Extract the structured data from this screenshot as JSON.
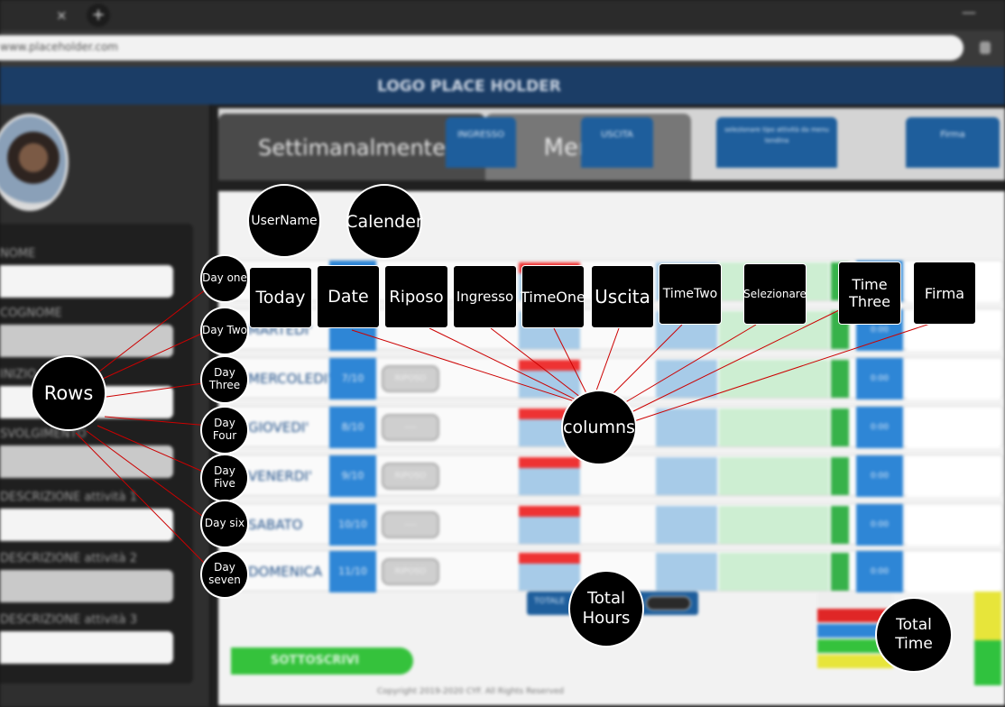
{
  "browser": {
    "tab_close": "×",
    "new_tab": "+",
    "minimize": "—",
    "url": "www.placeholder.com"
  },
  "app": {
    "logo": "LOGO PLACE HOLDER"
  },
  "sidebar": {
    "labels": [
      "NOME",
      "COGNOME",
      "INIZIO",
      "SVOLGIMENTO",
      "DESCRIZIONE attività 1",
      "DESCRIZIONE attività 2",
      "DESCRIZIONE attività 3"
    ]
  },
  "tabs": {
    "weekly": "Settimanalmente",
    "monthly": "Mensile"
  },
  "table": {
    "headers": {
      "ingresso": "INGRESSO",
      "uscita": "USCITA",
      "selezionare": "selezionare tipo attività da menu tendina",
      "firma": "Firma"
    },
    "rows": [
      {
        "day": "",
        "date": "",
        "riposo": ""
      },
      {
        "day": "MARTEDI'",
        "date": "",
        "riposo": ""
      },
      {
        "day": "MERCOLEDI'",
        "date": "7/10",
        "riposo": "RIPOSO"
      },
      {
        "day": "GIOVEDI'",
        "date": "8/10",
        "riposo": "----"
      },
      {
        "day": "VENERDI'",
        "date": "9/10",
        "riposo": "RIPOSO"
      },
      {
        "day": "SABATO",
        "date": "10/10",
        "riposo": "----"
      },
      {
        "day": "DOMENICA",
        "date": "11/10",
        "riposo": "RIPOSO"
      }
    ],
    "time_placeholder": "0:00"
  },
  "totals": {
    "label": "TOTALE",
    "value": "0:00:00"
  },
  "subscribe_button": "SOTTOSCRIVI",
  "footer": "Copyright 2019-2020 CYF. All Rights Reserved",
  "annotations": {
    "username": "UserName",
    "calender": "Calender",
    "columns_label": "columns",
    "rows_label": "Rows",
    "total_hours": "Total Hours",
    "total_time": "Total Time",
    "column_boxes": [
      "Today",
      "Date",
      "Riposo",
      "Ingresso",
      "TimeOne",
      "Uscita",
      "TimeTwo",
      "Selezionare",
      "Time Three",
      "Firma"
    ],
    "days": [
      "Day one",
      "Day Two",
      "Day Three",
      "Day Four",
      "Day Five",
      "Day six",
      "Day seven"
    ]
  },
  "colors": {
    "annotation_bg": "#000000",
    "connector": "#cc0000",
    "brand_blue": "#1e5e9c",
    "accent_green": "#35c23c"
  }
}
